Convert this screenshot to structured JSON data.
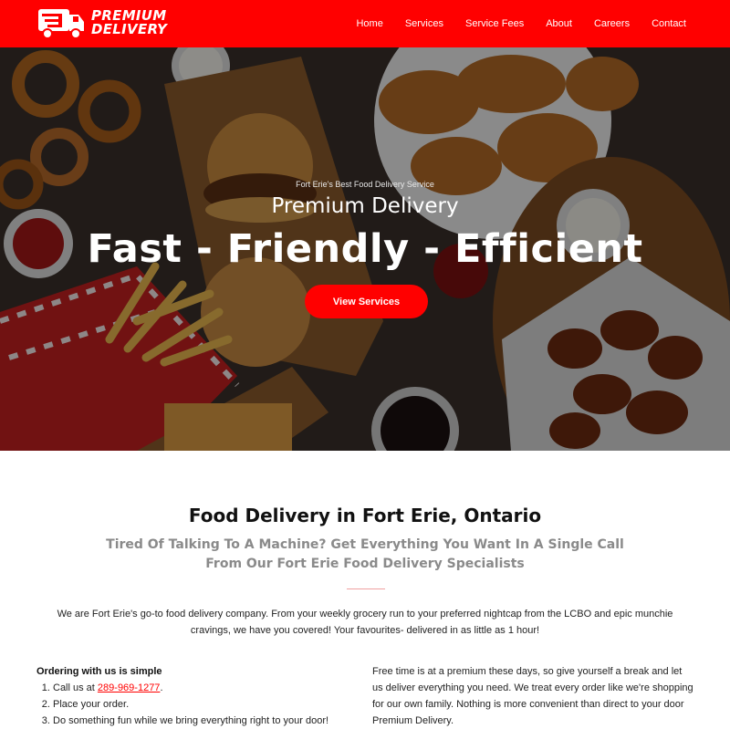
{
  "brand": {
    "line1": "PREMIUM",
    "line2": "DELIVERY",
    "icon": "delivery-truck-icon",
    "color": "#ff0000"
  },
  "nav": [
    {
      "label": "Home"
    },
    {
      "label": "Services"
    },
    {
      "label": "Service Fees"
    },
    {
      "label": "About"
    },
    {
      "label": "Careers"
    },
    {
      "label": "Contact"
    }
  ],
  "hero": {
    "eyebrow": "Fort Erie's Best Food Delivery Service",
    "subtitle": "Premium Delivery",
    "title": "Fast - Friendly - Efficient",
    "button": "View Services"
  },
  "section": {
    "title": "Food Delivery in Fort Erie, Ontario",
    "subtitle": "Tired Of Talking To A Machine? Get Everything You Want In A Single Call From Our Fort Erie Food Delivery Specialists",
    "intro": "We are Fort Erie's go-to food delivery company. From your weekly grocery run to your preferred nightcap from the LCBO and epic munchie cravings, we have you covered! Your favourites- delivered in as little as 1 hour!"
  },
  "ordering": {
    "heading": "Ordering with us is simple",
    "step1_prefix": "Call us at ",
    "phone": "289-969-1277",
    "step1_suffix": ".",
    "step2": "Place your order.",
    "step3": "Do something fun while we bring everything right to your door!"
  },
  "right_text": "Free time is at a premium these days, so give yourself a break and let us deliver everything you need. We treat every order like we're shopping for our own family. Nothing is more convenient than direct to your door Premium Delivery."
}
